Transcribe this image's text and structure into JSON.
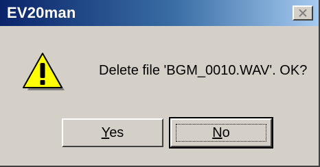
{
  "window": {
    "title": "EV20man"
  },
  "icons": {
    "close": "close-icon",
    "warning": "warning-icon"
  },
  "message": {
    "text": "Delete file 'BGM_0010.WAV'. OK?"
  },
  "buttons": {
    "yes": {
      "mnemonic": "Y",
      "rest": "es"
    },
    "no": {
      "mnemonic": "N",
      "rest": "o"
    }
  },
  "colors": {
    "titlebar_start": "#0a246a",
    "titlebar_end": "#a6caf0",
    "dialog_bg": "#d4d0c8",
    "warning_fill": "#ffff00"
  }
}
